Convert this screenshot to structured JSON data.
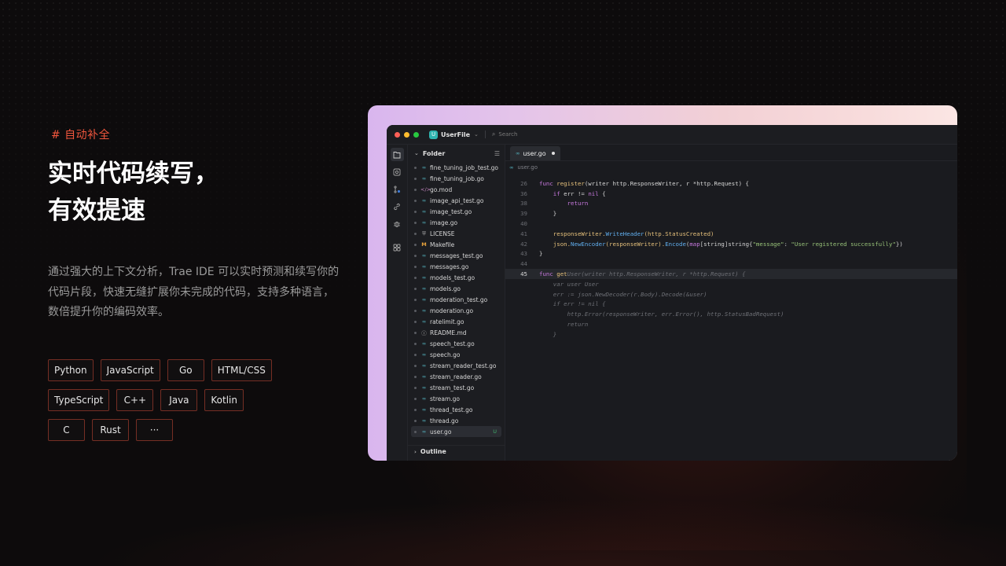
{
  "hero": {
    "tag": "# 自动补全",
    "title_line1": "实时代码续写，",
    "title_line2": "有效提速",
    "desc_line1": "通过强大的上下文分析，Trae IDE 可以实时预测和续写你的",
    "desc_line2": "代码片段，快速无缝扩展你未完成的代码，支持多种语言，",
    "desc_line3": "数倍提升你的编码效率。"
  },
  "languages": [
    [
      "Python",
      "JavaScript",
      "Go",
      "HTML/CSS"
    ],
    [
      "TypeScript",
      "C++",
      "Java",
      "Kotlin"
    ],
    [
      "C",
      "Rust",
      "···"
    ]
  ],
  "colors": {
    "accent": "#f0563d",
    "frame_gradient_start": "#d9b6ee",
    "frame_gradient_end": "#fbe6e4",
    "ide_bg": "#1a1b1f"
  },
  "ide": {
    "project_badge": "U",
    "project_name": "UserFile",
    "search_placeholder": "Search",
    "explorer_title": "Folder",
    "outline_title": "Outline",
    "files": [
      {
        "name": "fine_tuning_job_test.go",
        "icon": "go"
      },
      {
        "name": "fine_tuning_job.go",
        "icon": "go"
      },
      {
        "name": "go.mod",
        "icon": "mod"
      },
      {
        "name": "image_api_test.go",
        "icon": "go"
      },
      {
        "name": "image_test.go",
        "icon": "go"
      },
      {
        "name": "image.go",
        "icon": "go"
      },
      {
        "name": "LICENSE",
        "icon": "license"
      },
      {
        "name": "Makefile",
        "icon": "makefile"
      },
      {
        "name": "messages_test.go",
        "icon": "go"
      },
      {
        "name": "messages.go",
        "icon": "go"
      },
      {
        "name": "models_test.go",
        "icon": "go"
      },
      {
        "name": "models.go",
        "icon": "go"
      },
      {
        "name": "moderation_test.go",
        "icon": "go"
      },
      {
        "name": "moderation.go",
        "icon": "go"
      },
      {
        "name": "ratelimit.go",
        "icon": "go"
      },
      {
        "name": "README.md",
        "icon": "info"
      },
      {
        "name": "speech_test.go",
        "icon": "go"
      },
      {
        "name": "speech.go",
        "icon": "go"
      },
      {
        "name": "stream_reader_test.go",
        "icon": "go"
      },
      {
        "name": "stream_reader.go",
        "icon": "go"
      },
      {
        "name": "stream_test.go",
        "icon": "go"
      },
      {
        "name": "stream.go",
        "icon": "go"
      },
      {
        "name": "thread_test.go",
        "icon": "go"
      },
      {
        "name": "thread.go",
        "icon": "go"
      },
      {
        "name": "user.go",
        "icon": "go",
        "selected": true,
        "status": "U"
      }
    ],
    "tab_label": "user.go",
    "breadcrumb": "user.go",
    "code_lines": [
      {
        "n": "26",
        "segments": [
          [
            "func ",
            "#c678dd"
          ],
          [
            "register",
            "#e5c07b"
          ],
          [
            "(writer http.ResponseWriter, r *http.Request) {",
            "#d4d4d4"
          ]
        ]
      },
      {
        "n": "36",
        "segments": [
          [
            "    if ",
            "#c678dd"
          ],
          [
            "err != ",
            "#d4d4d4"
          ],
          [
            "nil",
            "#c678dd"
          ],
          [
            " {",
            "#d4d4d4"
          ]
        ]
      },
      {
        "n": "38",
        "segments": [
          [
            "        return",
            "#c678dd"
          ]
        ]
      },
      {
        "n": "39",
        "segments": [
          [
            "    }",
            "#d4d4d4"
          ]
        ]
      },
      {
        "n": "40",
        "segments": [
          [
            "",
            "#d4d4d4"
          ]
        ]
      },
      {
        "n": "41",
        "segments": [
          [
            "    responseWriter.",
            "#e5c07b"
          ],
          [
            "WriteHeader",
            "#61afef"
          ],
          [
            "(http.StatusCreated)",
            "#e5c07b"
          ]
        ]
      },
      {
        "n": "42",
        "segments": [
          [
            "    json.",
            "#e5c07b"
          ],
          [
            "NewEncoder",
            "#61afef"
          ],
          [
            "(responseWriter).",
            "#e5c07b"
          ],
          [
            "Encode",
            "#61afef"
          ],
          [
            "(",
            "#d4d4d4"
          ],
          [
            "map",
            "#c678dd"
          ],
          [
            "[string]string{",
            "#d4d4d4"
          ],
          [
            "\"message\"",
            "#98c379"
          ],
          [
            ": ",
            "#d4d4d4"
          ],
          [
            "\"User registered successfully\"",
            "#98c379"
          ],
          [
            "})",
            "#d4d4d4"
          ]
        ]
      },
      {
        "n": "43",
        "segments": [
          [
            "}",
            "#d4d4d4"
          ]
        ]
      },
      {
        "n": "44",
        "segments": [
          [
            "",
            "#d4d4d4"
          ]
        ]
      },
      {
        "n": "45",
        "current": true,
        "segments": [
          [
            "func ",
            "#c678dd"
          ],
          [
            "get",
            "#e5c07b"
          ],
          [
            "User(writer http.ResponseWriter, r *http.Request) {",
            "ghost"
          ]
        ]
      },
      {
        "n": "",
        "segments": [
          [
            "    var user User",
            "ghost"
          ]
        ]
      },
      {
        "n": "",
        "segments": [
          [
            "    err := json.NewDecoder(r.Body).Decode(&user)",
            "ghost"
          ]
        ]
      },
      {
        "n": "",
        "segments": [
          [
            "    if err != nil {",
            "ghost"
          ]
        ]
      },
      {
        "n": "",
        "segments": [
          [
            "        http.Error(responseWriter, err.Error(), http.StatusBadRequest)",
            "ghost"
          ]
        ]
      },
      {
        "n": "",
        "segments": [
          [
            "        return",
            "ghost"
          ]
        ]
      },
      {
        "n": "",
        "segments": [
          [
            "    }",
            "ghost"
          ]
        ]
      }
    ]
  }
}
